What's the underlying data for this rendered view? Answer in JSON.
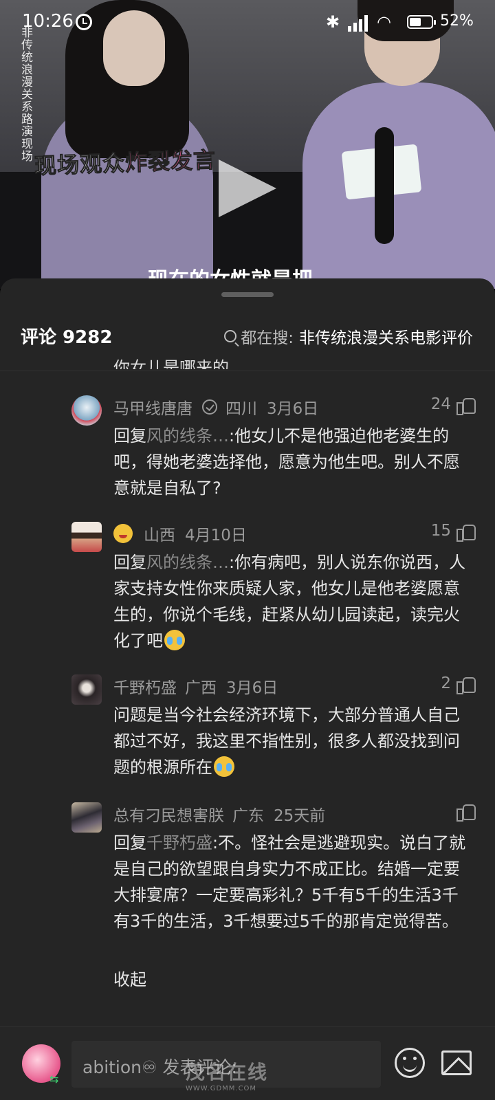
{
  "status_bar": {
    "time": "10:26",
    "battery_percent": "52%",
    "battery_level": 0.52,
    "icons": [
      "alarm-icon",
      "bluetooth-icon",
      "signal-icon",
      "wifi-icon",
      "battery-icon"
    ]
  },
  "video": {
    "side_title": "非传统浪漫关系路演现场",
    "caption_plain": "现场观众",
    "caption_highlight": "炸裂发言",
    "subtitle": "现在的女性就是把"
  },
  "comments_header": {
    "count_label": "评论 9282",
    "search_prefix": "都在搜:",
    "search_keyword": "非传统浪漫关系电影评价"
  },
  "clipped_previous_line": "你女儿是哪来的",
  "comments": [
    {
      "name": "马甲线唐唐",
      "verified": true,
      "location": "四川",
      "date": "3月6日",
      "likes": "24",
      "reply_prefix": "回复",
      "reply_target": "风的线条…",
      "text": ":他女儿不是他强迫他老婆生的吧，得她老婆选择他，愿意为他生吧。别人不愿意就是自私了?"
    },
    {
      "name": "",
      "emoji_name": "goofy-face-icon",
      "location": "山西",
      "date": "4月10日",
      "likes": "15",
      "reply_prefix": "回复",
      "reply_target": "风的线条…",
      "text": ":你有病吧，别人说东你说西，人家支持女性你来质疑人家，他女儿是他老婆愿意生的，你说个毛线，赶紧从幼儿园读起，读完火化了吧",
      "trailing_emoji": "crying-face-icon"
    },
    {
      "name": "千野朽盛",
      "location": "广西",
      "date": "3月6日",
      "likes": "2",
      "reply_prefix": "",
      "reply_target": "",
      "text": "问题是当今社会经济环境下，大部分普通人自己都过不好，我这里不指性别，很多人都没找到问题的根源所在",
      "trailing_emoji": "crying-face-icon"
    },
    {
      "name": "总有刁民想害朕",
      "location": "广东",
      "date": "25天前",
      "likes": "",
      "reply_prefix": "回复",
      "reply_target": "千野朽盛",
      "text": ":不。怪社会是逃避现实。说白了就是自己的欲望跟自身实力不成正比。结婚一定要大排宴席？一定要高彩礼？5千有5千的生活3千有3千的生活，3千想要过5千的那肯定觉得苦。",
      "collapse_label": "收起"
    }
  ],
  "input_bar": {
    "placeholder": "abition♾ 发表评论:",
    "avatar_badge": "⇆"
  },
  "watermark": {
    "text": "茂名在线",
    "url": "WWW.GDMM.COM"
  },
  "colors": {
    "sheet_bg": "#252525",
    "text_primary": "#e6e6e6",
    "text_secondary": "#9a9a9a",
    "caption_highlight": "#ff5f9e"
  }
}
